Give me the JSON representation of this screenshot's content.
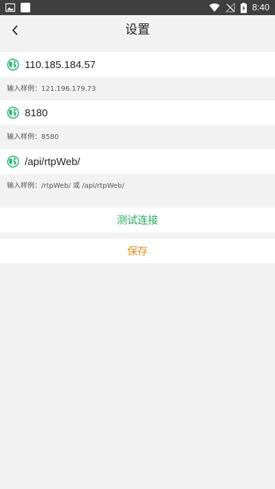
{
  "status_bar": {
    "time": "8:40",
    "icons": [
      "image-icon",
      "notification-square-icon",
      "wifi-icon",
      "signal-off-icon",
      "battery-charging-icon"
    ],
    "bg_color": "#3f3f3f"
  },
  "header": {
    "title": "设置",
    "back_icon": "back-chevron-icon"
  },
  "fields": [
    {
      "value": "110.185.184.57",
      "hint": "输入样例：121.196.179.73",
      "icon": "globe-icon"
    },
    {
      "value": "8180",
      "hint": "输入样例：8580",
      "icon": "globe-icon"
    },
    {
      "value": "/api/rtpWeb/",
      "hint": "输入样例：/rtpWeb/ 或 /api/rtpWeb/",
      "icon": "globe-icon"
    }
  ],
  "actions": {
    "test_label": "测试连接",
    "save_label": "保存"
  },
  "colors": {
    "accent_green": "#22a85a",
    "accent_orange": "#e8901a",
    "background": "#f2f2f2"
  }
}
